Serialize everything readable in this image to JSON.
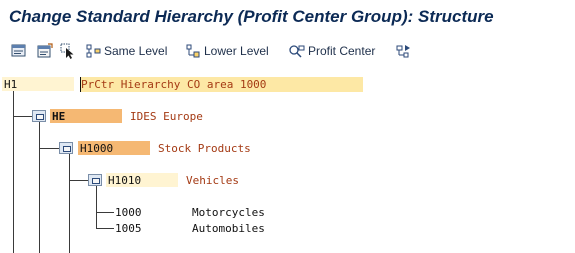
{
  "title": "Change Standard Hierarchy (Profit Center Group): Structure",
  "toolbar": {
    "same_level": "Same Level",
    "lower_level": "Lower Level",
    "profit_center": "Profit Center"
  },
  "tree": {
    "root": {
      "code": "H1",
      "desc": "PrCtr Hierarchy CO area 1000"
    },
    "level1": {
      "code": "HE",
      "desc": "IDES Europe"
    },
    "level2": {
      "code": "H1000",
      "desc": "Stock Products"
    },
    "level3": {
      "code": "H1010",
      "desc": "Vehicles"
    },
    "leaves": [
      {
        "code": "1000",
        "desc": "Motorcycles"
      },
      {
        "code": "1005",
        "desc": "Automobiles"
      }
    ]
  }
}
